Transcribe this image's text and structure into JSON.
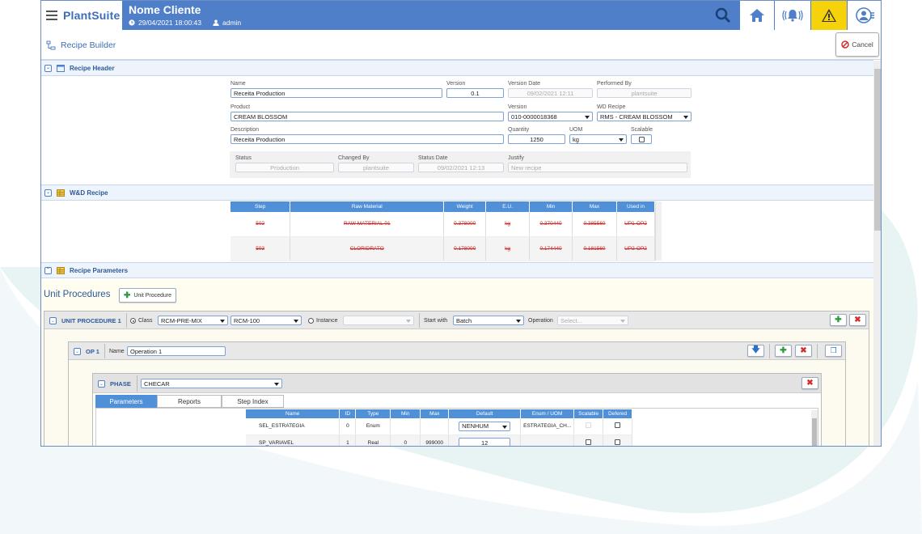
{
  "app": {
    "logo_text": "PlantSuite",
    "client_name": "Nome Cliente",
    "datetime": "29/04/2021 18:00:43",
    "user": "admin"
  },
  "topbar_icons": [
    "search-icon",
    "home-icon",
    "alarm-bell-icon",
    "warning-icon",
    "user-profile-icon"
  ],
  "page": {
    "title": "Recipe Builder",
    "cancel_label": "Cancel"
  },
  "recipe_header": {
    "title": "Recipe Header",
    "labels": {
      "name": "Name",
      "version": "Version",
      "version_date": "Version Date",
      "performed_by": "Performed By",
      "product": "Product",
      "version2": "Version",
      "wd_recipe": "WD Recipe",
      "description": "Description",
      "quantity": "Quantity",
      "uom": "UOM",
      "scalable": "Scalable",
      "status": "Status",
      "changed_by": "Changed By",
      "status_date": "Status Date",
      "justify": "Justify"
    },
    "values": {
      "name": "Receita Production",
      "version": "0.1",
      "version_date": "09/02/2021 12:11",
      "performed_by": "plantsuite",
      "product": "CREAM BLOSSOM",
      "version2": "010-0000018368",
      "wd_recipe": "RMS - CREAM BLOSSOM",
      "description": "Receita Production",
      "quantity": "1250",
      "uom": "kg",
      "status": "Production",
      "changed_by": "plantsuite",
      "status_date": "09/02/2021 12:13",
      "justify": "New recipe"
    }
  },
  "wd_recipe": {
    "title": "W&D Recipe",
    "columns": [
      "Step",
      "Raw Material",
      "Weight",
      "E.U.",
      "Min",
      "Max",
      "Used in"
    ],
    "rows": [
      [
        "502",
        "RAW MATERIAL 01",
        "0.378000",
        "kg",
        "0.370440",
        "0.385560",
        "UP1-OP2"
      ],
      [
        "503",
        "CLORIDRATO",
        "0.178000",
        "kg",
        "0.174440",
        "0.181560",
        "UP2-OP2"
      ]
    ]
  },
  "recipe_parameters": {
    "title": "Recipe Parameters"
  },
  "unit_procedures": {
    "title": "Unit Procedures",
    "add_button": "Unit Procedure",
    "up": {
      "label": "UNIT PROCEDURE 1",
      "class_label": "Class",
      "class_value": "RCM-PRE-MIX",
      "equipment_value": "RCM-100",
      "instance_label": "Instance",
      "instance_value": "",
      "start_with_label": "Start with",
      "start_with_value": "Batch",
      "operation_label": "Operation",
      "operation_placeholder": "Select..."
    },
    "op": {
      "label": "OP 1",
      "name_label": "Name",
      "name_value": "Operation 1"
    },
    "phase": {
      "label": "PHASE",
      "value": "CHECAR",
      "tabs": [
        "Parameters",
        "Reports",
        "Step Index"
      ],
      "columns": [
        "Name",
        "ID",
        "Type",
        "Min",
        "Max",
        "Default",
        "Enum / UOM",
        "Scalable",
        "Defered"
      ],
      "rows": [
        {
          "name": "SEL_ESTRATEGIA",
          "id": "0",
          "type": "Enum",
          "min": "",
          "max": "",
          "default": "NENHUM",
          "enum_uom": "ESTRATEGIA_CH..."
        },
        {
          "name": "SP_VARIAVEL",
          "id": "1",
          "type": "Real",
          "min": "0",
          "max": "999000",
          "default": "12",
          "enum_uom": ""
        }
      ]
    }
  },
  "colors": {
    "topbar": "#4f7fc9",
    "table_header": "#4f90d9",
    "warning_bg": "#f5d20a",
    "strike_red": "#c62828",
    "add_green": "#2e9b3c",
    "delete_red": "#d32f2f"
  }
}
